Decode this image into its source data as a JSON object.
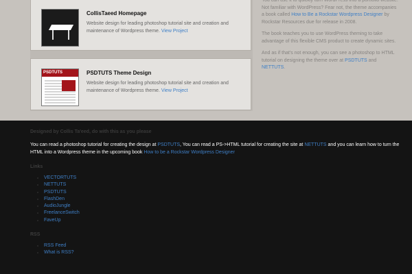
{
  "projects": [
    {
      "title": "CollisTaeed Homepage",
      "description": "Website design for leading photoshop tutorial site and creation and maintenance of Wordpress theme.",
      "link_label": "View Project",
      "thumb_icon": "desk-thumbnail"
    },
    {
      "title": "PSDTUTS Theme Design",
      "description": "Website design for leading photoshop tutorial site and creation and maintenance of Wordpress theme.",
      "link_label": "View Project",
      "thumb_icon": "psdtuts-thumbnail",
      "thumb_label": "PSDTUTS"
    }
  ],
  "sidebar": {
    "p1_text": "You can use it to quickly turn WordPress into a portfolio website. Not familiar with WordPress? Fear not, the theme accompanies a book called ",
    "p1_link": "How to Be a Rockstar Wordpress Designer",
    "p1_text_end": " by Rockstar Resources due for release in 2008.",
    "p2_text": "The book teaches you to use WordPress theming to take advantage of this flexible CMS product to create dynamic sites.",
    "p3_text": "And as if that's not enough, you can see a photoshop to HTML tutorial on designing the theme over at ",
    "p3_link1": "PSDTUTS",
    "p3_and": " and ",
    "p3_link2": "NETTUTS",
    "p3_end": "."
  },
  "footer": {
    "credit": "Designed by Collis Ta'eed, do with this as you please",
    "intro_1": "You can read a photoshop tutorial for creating the design at ",
    "intro_link1": "PSDTUTS",
    "intro_2": ", You can read a PS->HTML tutorial for creating the site at ",
    "intro_link2": "NETTUTS",
    "intro_3": " and you can learn how to turn the HTML into a Wordpress theme in the upcoming book ",
    "intro_link3": "How to be a Rockstar Wordpress Designer",
    "links_heading": "Links",
    "links": [
      "VECTORTUTS",
      "NETTUTS",
      "PSDTUTS",
      "FlashDen",
      "AudioJungle",
      "FreelanceSwitch",
      "FaveUp"
    ],
    "rss_heading": "RSS",
    "rss": [
      "RSS Feed",
      "What is RSS?"
    ]
  },
  "colors": {
    "link": "#3f7fc6",
    "footer_bg": "#141414",
    "content_bg": "#c6c2bd",
    "card_bg": "#e4e2df",
    "psdtuts_red": "#a3141a"
  }
}
